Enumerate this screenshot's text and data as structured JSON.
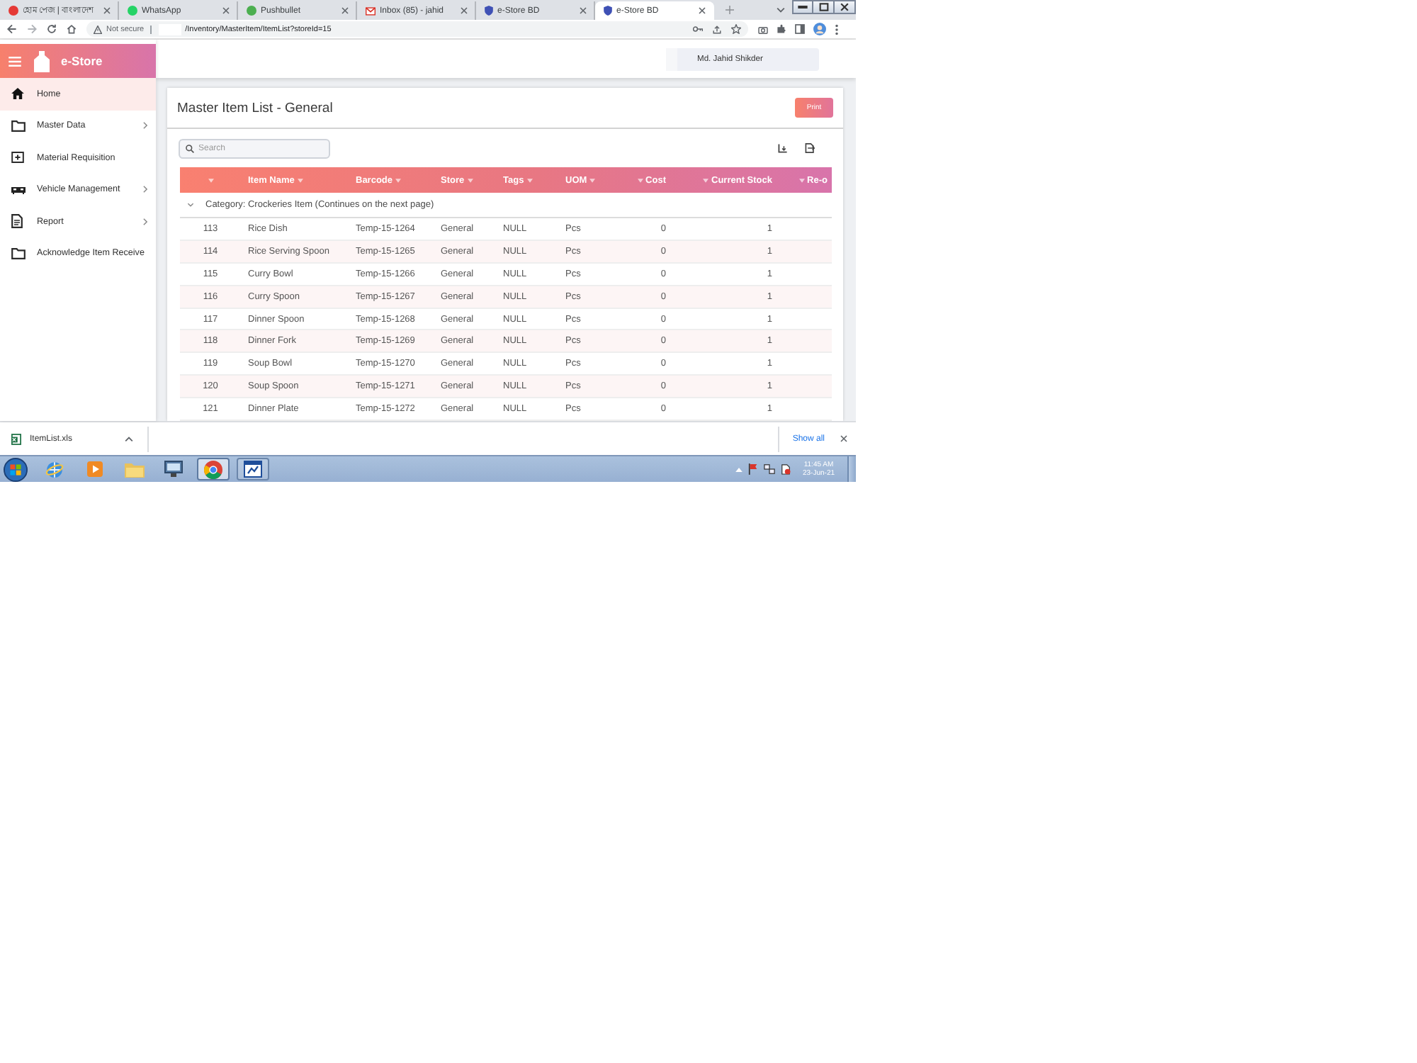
{
  "browser": {
    "tabs": [
      {
        "title": "হোম পেজ | বাংলাদেশ",
        "kind": "dot",
        "color": "#e53935",
        "selected": false
      },
      {
        "title": "WhatsApp",
        "kind": "dot",
        "color": "#25d366",
        "selected": false
      },
      {
        "title": "Pushbullet",
        "kind": "dot",
        "color": "#4caf50",
        "selected": false
      },
      {
        "title": "Inbox (85) - jahid",
        "kind": "mail",
        "color": "#d93025",
        "selected": false
      },
      {
        "title": "e-Store BD",
        "kind": "badge",
        "color": "#3f51b5",
        "selected": false
      },
      {
        "title": "e-Store BD",
        "kind": "badge",
        "color": "#3f51b5",
        "selected": true
      }
    ],
    "address": {
      "security": "Not secure",
      "url": "/Inventory/MasterItem/ItemList?storeId=15"
    }
  },
  "app": {
    "logo": "e-Store",
    "user": "Md. Jahid Shikder",
    "sidebar": [
      {
        "label": "Home",
        "kind": "home",
        "selected": true,
        "submenu": false
      },
      {
        "label": "Master Data",
        "kind": "folder",
        "selected": false,
        "submenu": true
      },
      {
        "label": "Material Requisition",
        "kind": "add-box",
        "selected": false,
        "submenu": false
      },
      {
        "label": "Vehicle Management",
        "kind": "car",
        "selected": false,
        "submenu": true
      },
      {
        "label": "Report",
        "kind": "document",
        "selected": false,
        "submenu": true
      },
      {
        "label": "Acknowledge Item Receive",
        "kind": "folder",
        "selected": false,
        "submenu": false
      }
    ]
  },
  "card": {
    "title": "Master Item List - General",
    "button": "Print",
    "search": {
      "placeholder": "Search"
    },
    "table": {
      "columns": [
        {
          "kind": "index"
        },
        {
          "label": "Item Name",
          "kind": "text"
        },
        {
          "label": "Barcode",
          "kind": "text"
        },
        {
          "label": "Store",
          "kind": "text"
        },
        {
          "label": "Tags",
          "kind": "text"
        },
        {
          "label": "UOM",
          "kind": "text"
        },
        {
          "label": "Cost",
          "kind": "number"
        },
        {
          "label": "Current Stock",
          "kind": "number"
        },
        {
          "label": "Re-o",
          "kind": "number"
        }
      ],
      "group": {
        "label": "Category: Crockeries Item (Continues on the next page)",
        "expanded": true
      },
      "rows": [
        [
          "113",
          "Rice Dish",
          "Temp-15-1264",
          "General",
          "NULL",
          "Pcs",
          "0",
          "1"
        ],
        [
          "114",
          "Rice Serving Spoon",
          "Temp-15-1265",
          "General",
          "NULL",
          "Pcs",
          "0",
          "1"
        ],
        [
          "115",
          "Curry Bowl",
          "Temp-15-1266",
          "General",
          "NULL",
          "Pcs",
          "0",
          "1"
        ],
        [
          "116",
          "Curry Spoon",
          "Temp-15-1267",
          "General",
          "NULL",
          "Pcs",
          "0",
          "1"
        ],
        [
          "117",
          "Dinner Spoon",
          "Temp-15-1268",
          "General",
          "NULL",
          "Pcs",
          "0",
          "1"
        ],
        [
          "118",
          "Dinner Fork",
          "Temp-15-1269",
          "General",
          "NULL",
          "Pcs",
          "0",
          "1"
        ],
        [
          "119",
          "Soup Bowl",
          "Temp-15-1270",
          "General",
          "NULL",
          "Pcs",
          "0",
          "1"
        ],
        [
          "120",
          "Soup Spoon",
          "Temp-15-1271",
          "General",
          "NULL",
          "Pcs",
          "0",
          "1"
        ],
        [
          "121",
          "Dinner Plate",
          "Temp-15-1272",
          "General",
          "NULL",
          "Pcs",
          "0",
          "1"
        ]
      ]
    }
  },
  "download_bar": {
    "file": "ItemList.xls",
    "show_all": "Show all"
  },
  "taskbar": {
    "apps": [
      {
        "kind": "globe",
        "selected": false,
        "open": false
      },
      {
        "kind": "play",
        "selected": false,
        "open": false
      },
      {
        "kind": "folder",
        "selected": false,
        "open": false
      },
      {
        "kind": "monitor",
        "selected": false,
        "open": false
      },
      {
        "kind": "browser",
        "selected": true,
        "open": true
      },
      {
        "kind": "document",
        "selected": false,
        "open": true
      }
    ],
    "clock": {
      "time": "11:45 AM",
      "date": "23-Jun-21"
    }
  }
}
